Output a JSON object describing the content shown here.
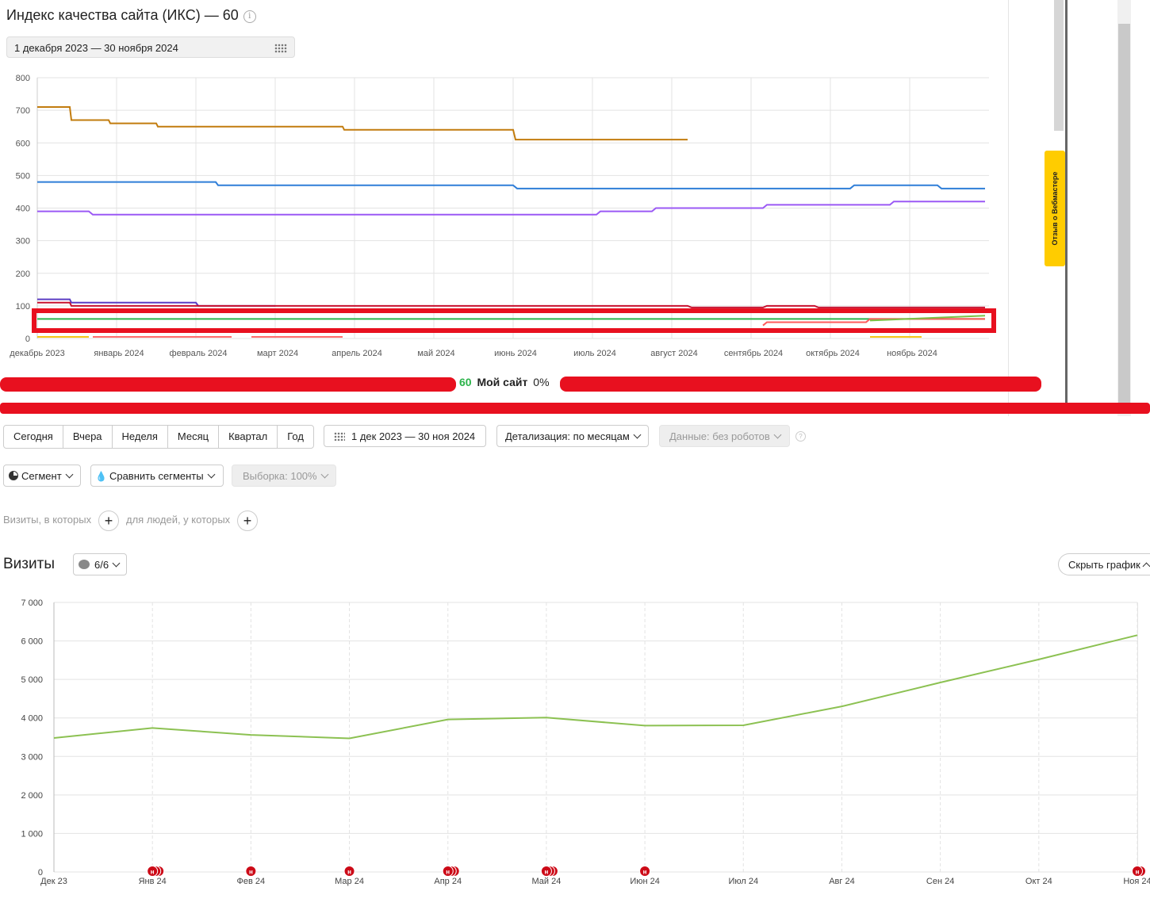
{
  "iks": {
    "title": "Индекс качества сайта (ИКС) — 60",
    "info_icon": "info-icon",
    "date_range": "1 декабря 2023 — 30 ноября 2024",
    "calendar_icon": "calendar-icon"
  },
  "side_panel": {
    "feedback_tab": "Отзыв о Вебмастере",
    "feedback_color": "#ffcc00"
  },
  "legend": {
    "value": "60",
    "value_color": "#2bb34a",
    "site_label": "Мой сайт",
    "percent": "0%"
  },
  "toolbar": {
    "periods": [
      "Сегодня",
      "Вчера",
      "Неделя",
      "Месяц",
      "Квартал",
      "Год"
    ],
    "date_range": "1 дек 2023 — 30 ноя 2024",
    "detail": "Детализация: по месяцам",
    "data": "Данные: без роботов"
  },
  "segments": {
    "segment": "Сегмент",
    "compare": "Сравнить сегменты",
    "sample": "Выборка: 100%"
  },
  "filters": {
    "visits_label": "Визиты, в которых",
    "people_label": "для людей, у которых"
  },
  "visits": {
    "title": "Визиты",
    "series_toggle": "6/6",
    "hide_chart": "Скрыть график"
  },
  "chart_data": [
    {
      "type": "line",
      "title": "",
      "xlabel": "",
      "ylabel": "",
      "ylim": [
        0,
        800
      ],
      "y_ticks": [
        "0",
        "100",
        "200",
        "300",
        "400",
        "500",
        "600",
        "700",
        "800"
      ],
      "x_ticks": [
        "декабрь 2023",
        "январь 2024",
        "февраль 2024",
        "март 2024",
        "апрель 2024",
        "май 2024",
        "июнь 2024",
        "июль 2024",
        "август 2024",
        "сентябрь 2024",
        "октябрь 2024",
        "ноябрь 2024"
      ],
      "grid": true,
      "series": [
        {
          "color": "#c27c0e",
          "points": [
            [
              0,
              710
            ],
            [
              0.41,
              710
            ],
            [
              0.43,
              670
            ],
            [
              0.9,
              670
            ],
            [
              0.92,
              660
            ],
            [
              1.5,
              660
            ],
            [
              1.52,
              650
            ],
            [
              3.85,
              650
            ],
            [
              3.87,
              640
            ],
            [
              6.0,
              640
            ],
            [
              6.03,
              610
            ],
            [
              8.2,
              610
            ]
          ]
        },
        {
          "color": "#2f7ed8",
          "points": [
            [
              0,
              480
            ],
            [
              2.25,
              480
            ],
            [
              2.28,
              470
            ],
            [
              6.0,
              470
            ],
            [
              6.05,
              460
            ],
            [
              10.25,
              460
            ],
            [
              10.3,
              470
            ],
            [
              11.35,
              470
            ],
            [
              11.4,
              460
            ],
            [
              11.95,
              460
            ]
          ]
        },
        {
          "color": "#9b59f5",
          "points": [
            [
              0,
              390
            ],
            [
              0.65,
              390
            ],
            [
              0.7,
              380
            ],
            [
              7.05,
              380
            ],
            [
              7.1,
              390
            ],
            [
              7.75,
              390
            ],
            [
              7.8,
              400
            ],
            [
              9.15,
              400
            ],
            [
              9.2,
              410
            ],
            [
              10.75,
              410
            ],
            [
              10.8,
              420
            ],
            [
              11.95,
              420
            ]
          ]
        },
        {
          "color": "#5b3cc4",
          "points": [
            [
              0,
              120
            ],
            [
              0.41,
              120
            ],
            [
              0.43,
              110
            ],
            [
              2.0,
              110
            ],
            [
              2.03,
              100
            ],
            [
              3.0,
              100
            ]
          ]
        },
        {
          "color": "#c8102e",
          "points": [
            [
              0,
              110
            ],
            [
              0.41,
              110
            ],
            [
              0.43,
              100
            ],
            [
              8.2,
              100
            ],
            [
              8.25,
              95
            ],
            [
              9.15,
              95
            ],
            [
              9.2,
              100
            ],
            [
              9.8,
              100
            ],
            [
              9.85,
              95
            ],
            [
              11.95,
              95
            ]
          ]
        },
        {
          "color": "#2bb34a",
          "points": [
            [
              0,
              60
            ],
            [
              11.95,
              60
            ]
          ]
        },
        {
          "color": "#ff5a5a",
          "points": [
            [
              9.15,
              40
            ],
            [
              9.2,
              50
            ],
            [
              10.45,
              50
            ],
            [
              10.5,
              60
            ],
            [
              11.95,
              60
            ]
          ]
        },
        {
          "color": "#7bc043",
          "points": [
            [
              10.5,
              55
            ],
            [
              11.95,
              70
            ]
          ]
        },
        {
          "color": "#ff6b6b",
          "points": [
            [
              0.7,
              5
            ],
            [
              2.45,
              5
            ]
          ]
        },
        {
          "color": "#ff6b6b",
          "points": [
            [
              2.7,
              5
            ],
            [
              3.85,
              5
            ]
          ]
        },
        {
          "color": "#f5c518",
          "points": [
            [
              0,
              5
            ],
            [
              0.65,
              5
            ]
          ]
        },
        {
          "color": "#f5c518",
          "points": [
            [
              10.5,
              5
            ],
            [
              11.15,
              5
            ]
          ]
        }
      ]
    },
    {
      "type": "line",
      "title": "",
      "xlabel": "",
      "ylabel": "",
      "ylim": [
        0,
        7000
      ],
      "y_ticks": [
        "0",
        "1 000",
        "2 000",
        "3 000",
        "4 000",
        "5 000",
        "6 000",
        "7 000"
      ],
      "categories": [
        "Дек 23",
        "Янв 24",
        "Фев 24",
        "Мар 24",
        "Апр 24",
        "Май 24",
        "Июн 24",
        "Июл 24",
        "Авг 24",
        "Сен 24",
        "Окт 24",
        "Ноя 24"
      ],
      "grid": true,
      "series": [
        {
          "name": "Визиты",
          "color": "#8cc152",
          "values": [
            3480,
            3740,
            3560,
            3470,
            3960,
            4010,
            3800,
            3810,
            4300,
            4920,
            5520,
            6150
          ]
        }
      ],
      "annotations": [
        {
          "category": "Янв 24",
          "label": "н",
          "count": 3
        },
        {
          "category": "Фев 24",
          "label": "н",
          "count": 1
        },
        {
          "category": "Мар 24",
          "label": "н",
          "count": 1
        },
        {
          "category": "Апр 24",
          "label": "н",
          "count": 3
        },
        {
          "category": "Май 24",
          "label": "н",
          "count": 3
        },
        {
          "category": "Июн 24",
          "label": "н",
          "count": 1
        },
        {
          "category": "Ноя 24",
          "label": "н",
          "count": 2
        }
      ]
    }
  ]
}
